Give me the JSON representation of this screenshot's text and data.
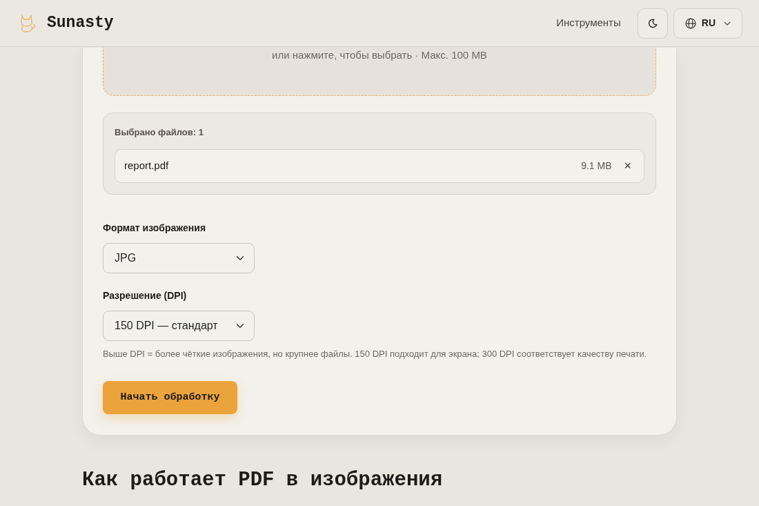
{
  "header": {
    "brand": "Sunasty",
    "nav": [
      {
        "label": "Инструменты"
      }
    ],
    "language": "RU"
  },
  "dropzone": {
    "hint": "или нажмите, чтобы выбрать · Макс. 100 MB"
  },
  "files": {
    "summary": "Выбрано файлов: 1",
    "items": [
      {
        "name": "report.pdf",
        "size": "9.1 MB",
        "remove": "×"
      }
    ]
  },
  "fields": [
    {
      "label": "Формат изображения",
      "value": "JPG"
    },
    {
      "label": "Разрешение (DPI)",
      "value": "150 DPI — стандарт"
    }
  ],
  "help": "Выше DPI = более чёткие изображения, но крупнее файлы. 150 DPI подходит для экрана; 300 DPI соответствует качеству печати.",
  "submit": "Начать обработку",
  "section_title": "Как работает PDF в изображения"
}
